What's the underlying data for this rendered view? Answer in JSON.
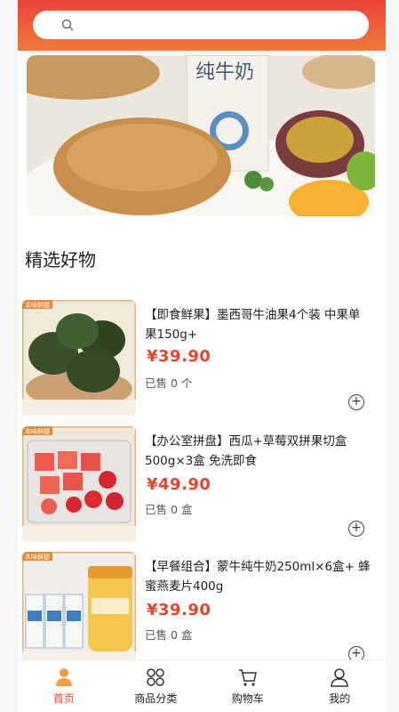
{
  "search": {
    "placeholder": ""
  },
  "section": {
    "title": "精选好物"
  },
  "products": [
    {
      "name": "【即食鲜果】墨西哥牛油果4个装 中果单果150g+",
      "price": "¥39.90",
      "sold": "已售 0 个",
      "thumb_tag": "本味鲜甜"
    },
    {
      "name": "【办公室拼盘】西瓜+草莓双拼果切盒500g×3盒 免洗即食",
      "price": "¥49.90",
      "sold": "已售 0 盒",
      "thumb_tag": "本味鲜甜"
    },
    {
      "name": "【早餐组合】蒙牛纯牛奶250ml×6盒+ 蜂蜜燕麦片400g",
      "price": "¥39.90",
      "sold": "已售 0 盒",
      "thumb_tag": "本味鲜甜"
    }
  ],
  "banner": {
    "carton_text": "纯牛奶"
  },
  "tabbar": [
    {
      "label": "首页",
      "icon": "home-icon",
      "active": true
    },
    {
      "label": "商品分类",
      "icon": "category-icon",
      "active": false
    },
    {
      "label": "购物车",
      "icon": "cart-icon",
      "active": false
    },
    {
      "label": "我的",
      "icon": "user-icon",
      "active": false
    }
  ],
  "colors": {
    "accent": "#e8452f",
    "header_top": "#e9443a",
    "header_bottom": "#f07a3a"
  }
}
